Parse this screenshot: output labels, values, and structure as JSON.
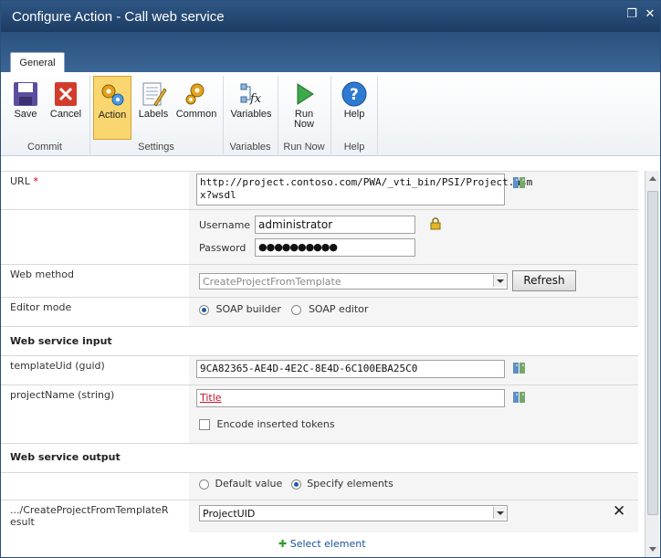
{
  "window": {
    "title": "Configure Action - Call web service",
    "restore_icon": "restore-icon",
    "close_icon": "close-icon"
  },
  "ribbon": {
    "tab": "General",
    "buttons": [
      {
        "label": "Save",
        "icon": "save-icon"
      },
      {
        "label": "Cancel",
        "icon": "cancel-icon"
      },
      {
        "label": "Action",
        "icon": "action-gears-icon",
        "active": true
      },
      {
        "label": "Labels",
        "icon": "labels-icon"
      },
      {
        "label": "Common",
        "icon": "common-gears-icon"
      },
      {
        "label": "Variables",
        "icon": "variables-fx-icon"
      },
      {
        "label": "Run",
        "label2": "Now",
        "icon": "run-icon"
      },
      {
        "label": "Help",
        "icon": "help-icon"
      }
    ],
    "groups": [
      "Commit",
      "Settings",
      "Variables",
      "Run Now",
      "Help"
    ]
  },
  "form": {
    "url": {
      "label": "URL",
      "required": "*",
      "value_line1": "http://project.contoso.com/PWA/_vti_bin/PSI/Project.asm",
      "value_line2": "x?wsdl"
    },
    "credentials": {
      "username_label": "Username",
      "username": "administrator",
      "password_label": "Password",
      "password": "●●●●●●●●●●"
    },
    "web_method": {
      "label": "Web method",
      "value": "CreateProjectFromTemplate",
      "refresh": "Refresh"
    },
    "editor_mode": {
      "label": "Editor mode",
      "soap_builder": "SOAP builder",
      "soap_editor": "SOAP editor",
      "selected": "soap_builder"
    },
    "input_section": "Web service input",
    "template_uid": {
      "label": "templateUid (guid)",
      "value": "9CA82365-AE4D-4E2C-8E4D-6C100EBA25C0"
    },
    "project_name": {
      "label": "projectName (string)",
      "value": "Title"
    },
    "encode": {
      "label": "Encode inserted tokens",
      "checked": false
    },
    "output_section": "Web service output",
    "output_mode": {
      "default_value": "Default value",
      "specify_elements": "Specify elements",
      "selected": "specify_elements"
    },
    "result": {
      "label_line1": ".../CreateProjectFromTemplateR",
      "label_line2": "esult",
      "value": "ProjectUID"
    },
    "select_element": "Select element"
  }
}
